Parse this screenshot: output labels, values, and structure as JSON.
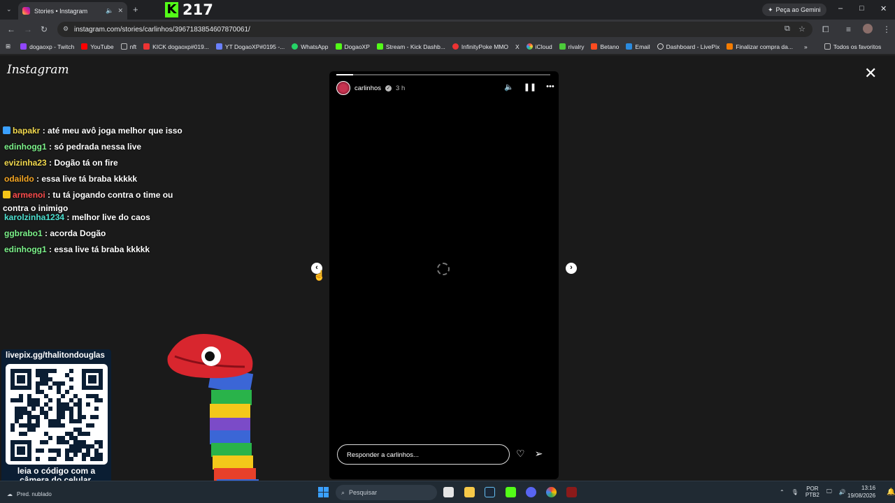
{
  "browser": {
    "tab_title": "Stories • Instagram",
    "url": "instagram.com/stories/carlinhos/3967183854607870061/",
    "gemini_label": "Peça ao Gemini",
    "bookmarks": [
      "dogaoxp - Twitch",
      "YouTube",
      "nft",
      "KICK dogaoxp#019...",
      "YT DogaoXP#0195 -...",
      "WhatsApp",
      "DogaoXP",
      "Stream - Kick Dashb...",
      "InfinityPoke MMO",
      "iCloud",
      "rivalry",
      "Betano",
      "Email",
      "Dashboard - LivePix",
      "Finalizar compra da..."
    ],
    "bookmarks_all": "Todos os favoritos"
  },
  "kick_overlay": {
    "viewer_count": "217"
  },
  "instagram": {
    "logo": "Instagram",
    "story": {
      "username": "carlinhos",
      "time_ago": "3 h",
      "progress": 0.08,
      "reply_placeholder": "Responder a carlinhos..."
    }
  },
  "chat": [
    {
      "user": "bapakr",
      "text": ": até meu avô joga melhor que isso",
      "color": "#f2d94e",
      "badge": "#3aa0ff"
    },
    {
      "user": "edinhogg1",
      "text": ": só pedrada nessa live",
      "color": "#7cf28a",
      "badge": ""
    },
    {
      "user": "evizinha23",
      "text": ": Dogão tá on fire",
      "color": "#f2d94e",
      "badge": ""
    },
    {
      "user": "odaildo",
      "text": ": essa live tá braba kkkkk",
      "color": "#f5a623",
      "badge": ""
    },
    {
      "user": "armenoi",
      "text": ": tu tá jogando contra o time ou",
      "text2": "contra o inimigo",
      "color": "#ff4d4d",
      "badge": "#f5c518"
    },
    {
      "user": "karolzinha1234",
      "text": ": melhor live do caos",
      "color": "#4de0d0",
      "badge": ""
    },
    {
      "user": "ggbrabo1",
      "text": ": acorda Dogão",
      "color": "#7cf28a",
      "badge": ""
    },
    {
      "user": "edinhogg1",
      "text": ": essa live tá braba kkkkk",
      "color": "#7cf28a",
      "badge": ""
    }
  ],
  "qr": {
    "url": "livepix.gg/thalitondouglas",
    "caption_line1": "leia o código com a",
    "caption_line2": "câmera do celular."
  },
  "taskbar": {
    "weather": "Pred. nublado",
    "search_placeholder": "Pesquisar",
    "lang_line1": "POR",
    "lang_line2": "PTB2",
    "time": "13:16",
    "date": "19/08/2026"
  }
}
